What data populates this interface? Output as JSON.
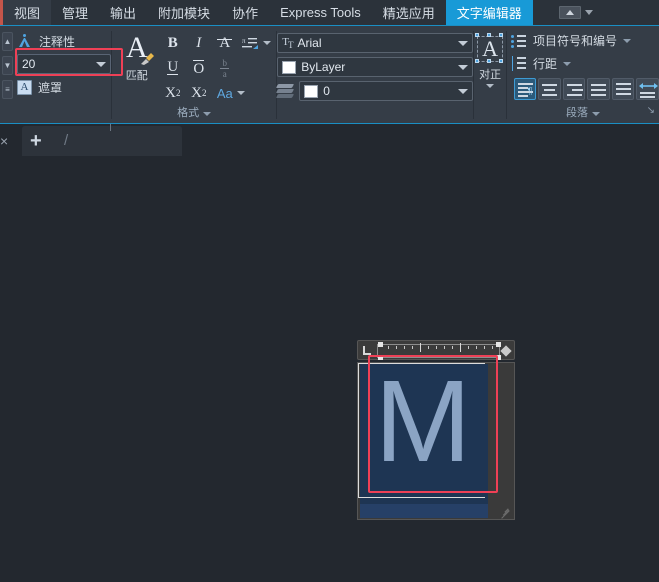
{
  "ribbon_tabs": [
    {
      "label": "视图",
      "state": "hover"
    },
    {
      "label": "管理",
      "state": "normal"
    },
    {
      "label": "输出",
      "state": "normal"
    },
    {
      "label": "附加模块",
      "state": "normal"
    },
    {
      "label": "协作",
      "state": "normal"
    },
    {
      "label": "Express Tools",
      "state": "normal"
    },
    {
      "label": "精选应用",
      "state": "normal"
    },
    {
      "label": "文字编辑器",
      "state": "active"
    }
  ],
  "annotation_panel": {
    "annotative_label": "注释性",
    "text_height_value": "20",
    "mask_label": "遮罩",
    "highlight_color": "#ef4056"
  },
  "formatting_panel": {
    "panel_label": "格式",
    "match_label": "匹配",
    "bold_label": "B",
    "italic_label": "I",
    "strike_label": "A",
    "case_change_label": "Aa",
    "underline_label": "U",
    "overline_label": "O",
    "stack_numerator": "b",
    "stack_denominator": "a",
    "superscript_base": "X",
    "superscript_exp": "2",
    "subscript_base": "X",
    "subscript_exp": "2",
    "font_value": "Arial",
    "color_value": "ByLayer",
    "layer_value": "0"
  },
  "justify_panel": {
    "label": "对正",
    "glyph": "A"
  },
  "paragraph_panel": {
    "panel_label": "段落",
    "bullets_label": "项目符号和编号",
    "line_spacing_label": "行距",
    "align_buttons": [
      {
        "name": "align-left",
        "active": true
      },
      {
        "name": "align-center",
        "active": false
      },
      {
        "name": "align-right",
        "active": false
      },
      {
        "name": "align-justify",
        "active": false
      },
      {
        "name": "align-distribute",
        "active": false
      },
      {
        "name": "paragraph-width",
        "active": false
      }
    ]
  },
  "tabstrip": {
    "close_label": "×",
    "new_tab_label": "+",
    "separator_label": "/"
  },
  "editor": {
    "text_content": "M",
    "text_color": "#8ba4c4",
    "selection_color": "#1e3553",
    "highlight_color": "#ef4056"
  },
  "colors": {
    "canvas_bg": "#23282f",
    "ribbon_bg": "#353d47",
    "tab_active": "#189ad7",
    "accent_blue": "#4ea3e0"
  }
}
